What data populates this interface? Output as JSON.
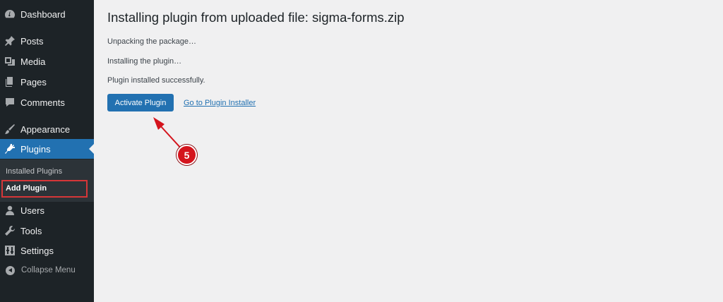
{
  "sidebar": {
    "items": [
      {
        "label": "Dashboard",
        "icon": "dashboard-icon"
      },
      {
        "label": "Posts",
        "icon": "pin-icon"
      },
      {
        "label": "Media",
        "icon": "media-icon"
      },
      {
        "label": "Pages",
        "icon": "pages-icon"
      },
      {
        "label": "Comments",
        "icon": "comments-icon"
      },
      {
        "label": "Appearance",
        "icon": "brush-icon"
      },
      {
        "label": "Plugins",
        "icon": "plugin-icon"
      },
      {
        "label": "Users",
        "icon": "user-icon"
      },
      {
        "label": "Tools",
        "icon": "wrench-icon"
      },
      {
        "label": "Settings",
        "icon": "settings-icon"
      }
    ],
    "submenu": [
      {
        "label": "Installed Plugins"
      },
      {
        "label": "Add Plugin"
      }
    ],
    "collapse_label": "Collapse Menu"
  },
  "main": {
    "title": "Installing plugin from uploaded file: sigma-forms.zip",
    "log": [
      "Unpacking the package…",
      "Installing the plugin…",
      "Plugin installed successfully."
    ],
    "activate_label": "Activate Plugin",
    "installer_link": "Go to Plugin Installer"
  },
  "annotation": {
    "step": "5"
  },
  "colors": {
    "sidebar_bg": "#1d2327",
    "accent": "#2271b1",
    "highlight": "#d63638",
    "badge": "#d4141d"
  }
}
